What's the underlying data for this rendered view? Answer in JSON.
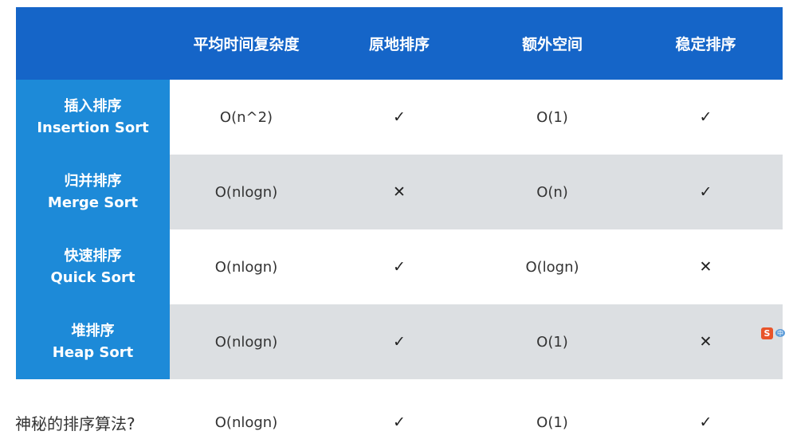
{
  "header": {
    "columns": [
      "平均时间复杂度",
      "原地排序",
      "额外空间",
      "稳定排序"
    ]
  },
  "rows": [
    {
      "zh": "插入排序",
      "en": "Insertion Sort",
      "time": "O(n^2)",
      "in_place": "✓",
      "space": "O(1)",
      "stable": "✓"
    },
    {
      "zh": "归并排序",
      "en": "Merge Sort",
      "time": "O(nlogn)",
      "in_place": "✕",
      "space": "O(n)",
      "stable": "✓"
    },
    {
      "zh": "快速排序",
      "en": "Quick Sort",
      "time": "O(nlogn)",
      "in_place": "✓",
      "space": "O(logn)",
      "stable": "✕"
    },
    {
      "zh": "堆排序",
      "en": "Heap Sort",
      "time": "O(nlogn)",
      "in_place": "✓",
      "space": "O(1)",
      "stable": "✕"
    }
  ],
  "mystery": {
    "label": "神秘的排序算法?",
    "time": "O(nlogn)",
    "in_place": "✓",
    "space": "O(1)",
    "stable": "✓"
  },
  "colors": {
    "header_bg": "#1565c8",
    "row_header_bg": "#1d8ad8",
    "alt_row_bg": "#dcdfe2"
  },
  "overlay_icon": {
    "name": "sogou-input-icon",
    "glyph_main": "S",
    "glyph_side": "中"
  }
}
